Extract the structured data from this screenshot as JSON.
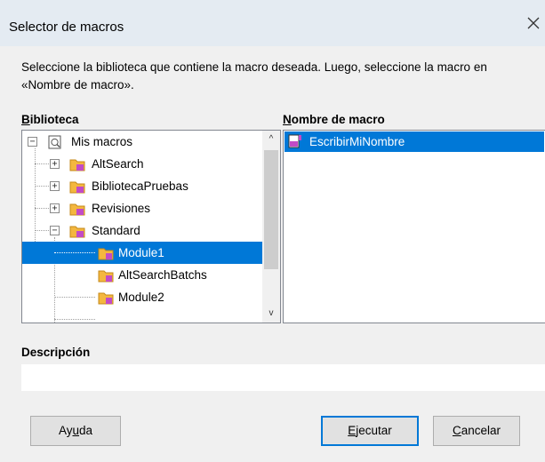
{
  "window": {
    "title": "Selector de macros"
  },
  "instruction": "Seleccione la biblioteca que contiene la macro deseada. Luego, seleccione la macro en «Nombre de macro».",
  "library": {
    "label_first": "B",
    "label_rest": "iblioteca",
    "items": [
      {
        "label": "Mis macros",
        "icon": "macro-container-icon"
      },
      {
        "label": "AltSearch",
        "icon": "folder-icon"
      },
      {
        "label": "BibliotecaPruebas",
        "icon": "folder-icon"
      },
      {
        "label": "Revisiones",
        "icon": "folder-icon"
      },
      {
        "label": "Standard",
        "icon": "folder-icon"
      },
      {
        "label": "Module1",
        "icon": "module-icon"
      },
      {
        "label": "AltSearchBatchs",
        "icon": "module-icon"
      },
      {
        "label": "Module2",
        "icon": "module-icon"
      }
    ]
  },
  "macro_name": {
    "label_first": "N",
    "label_rest": "ombre de macro",
    "items": [
      {
        "label": "EscribirMiNombre",
        "icon": "macro-icon"
      }
    ]
  },
  "description": {
    "label": "Descripción",
    "value": ""
  },
  "buttons": {
    "help_pre": "Ay",
    "help_u": "u",
    "help_post": "da",
    "run_u": "E",
    "run_post": "jecutar",
    "cancel_u": "C",
    "cancel_post": "ancelar"
  },
  "colors": {
    "selection": "#0078d7",
    "title_bg": "#e4ebf2",
    "folder": "#f4b73f"
  }
}
